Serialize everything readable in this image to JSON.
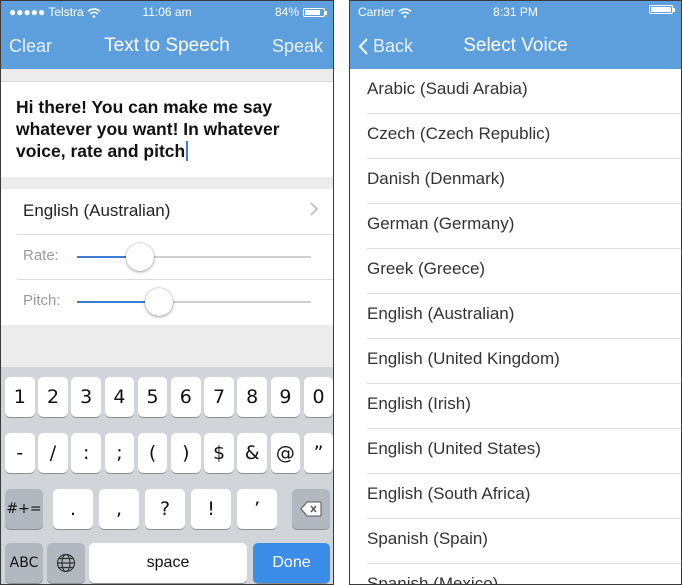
{
  "left": {
    "status": {
      "carrier": "●●●●● Telstra",
      "time": "11:06 am",
      "battery": "84%",
      "battery_level": 0.84
    },
    "nav": {
      "left": "Clear",
      "title": "Text to Speech",
      "right": "Speak"
    },
    "text": "Hi there! You can make me say whatever you want! In whatever voice, rate and pitch",
    "voice_label": "English (Australian)",
    "rate": {
      "label": "Rate:",
      "value": 0.27
    },
    "pitch": {
      "label": "Pitch:",
      "value": 0.35
    },
    "keyboard": {
      "row1": [
        "1",
        "2",
        "3",
        "4",
        "5",
        "6",
        "7",
        "8",
        "9",
        "0"
      ],
      "row2": [
        "-",
        "/",
        ":",
        ";",
        "(",
        ")",
        "$",
        "&",
        "@",
        "”"
      ],
      "row3": {
        "mode": "#+=",
        "keys": [
          ".",
          ",",
          "?",
          "!",
          "’"
        ]
      },
      "row4": {
        "abc": "ABC",
        "space": "space",
        "done": "Done"
      }
    }
  },
  "right": {
    "status": {
      "carrier": "Carrier",
      "time": "8:31 PM"
    },
    "nav": {
      "back": "Back",
      "title": "Select Voice"
    },
    "voices": [
      "Arabic (Saudi Arabia)",
      "Czech (Czech Republic)",
      "Danish (Denmark)",
      "German (Germany)",
      "Greek (Greece)",
      "English (Australian)",
      "English (United Kingdom)",
      "English (Irish)",
      "English (United States)",
      "English (South Africa)",
      "Spanish (Spain)",
      "Spanish (Mexico)"
    ]
  }
}
